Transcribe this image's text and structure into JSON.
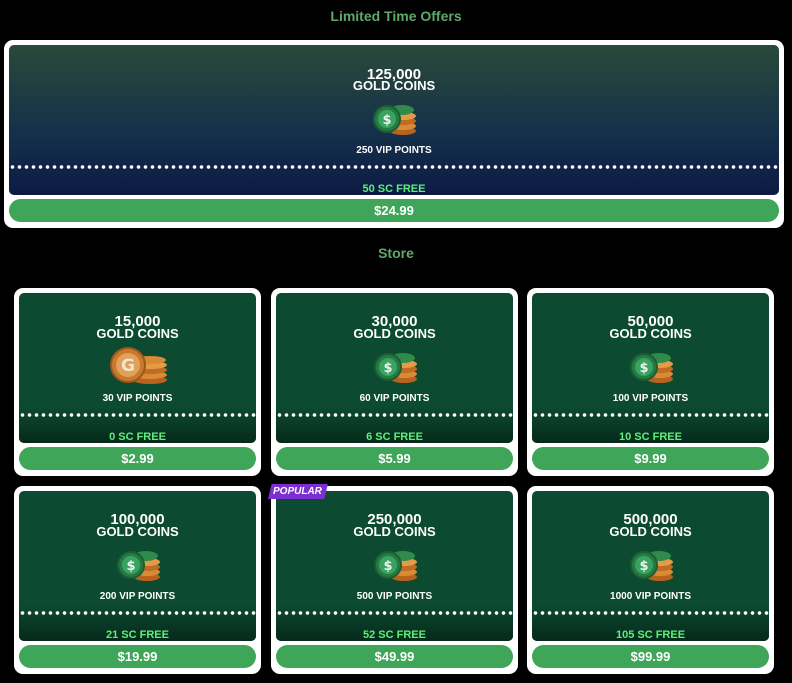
{
  "headings": {
    "limited": "Limited Time Offers",
    "store": "Store"
  },
  "colors": {
    "background": "#000000",
    "card_green": "#0c4a32",
    "price_button": "#3fa558",
    "sc_text": "#5cf07a",
    "heading": "#5fa86a",
    "popular_badge": "#7b2fd0"
  },
  "featured": {
    "amount": "125,000",
    "unit": "GOLD COINS",
    "icon": "green-coin-stack-icon",
    "vip": "250 VIP POINTS",
    "sc": "50 SC FREE",
    "price": "$24.99"
  },
  "packages": [
    {
      "amount": "15,000",
      "unit": "GOLD COINS",
      "icon": "gold-coin-stack-icon",
      "vip": "30 VIP POINTS",
      "sc": "0 SC FREE",
      "price": "$2.99"
    },
    {
      "amount": "30,000",
      "unit": "GOLD COINS",
      "icon": "green-coin-stack-icon",
      "vip": "60 VIP POINTS",
      "sc": "6 SC FREE",
      "price": "$5.99"
    },
    {
      "amount": "50,000",
      "unit": "GOLD COINS",
      "icon": "green-coin-stack-icon",
      "vip": "100 VIP POINTS",
      "sc": "10 SC FREE",
      "price": "$9.99"
    },
    {
      "amount": "100,000",
      "unit": "GOLD COINS",
      "icon": "green-coin-stack-icon",
      "vip": "200 VIP POINTS",
      "sc": "21 SC FREE",
      "price": "$19.99"
    },
    {
      "amount": "250,000",
      "unit": "GOLD COINS",
      "icon": "green-coin-stack-icon",
      "vip": "500 VIP POINTS",
      "sc": "52 SC FREE",
      "price": "$49.99",
      "badge": "POPULAR"
    },
    {
      "amount": "500,000",
      "unit": "GOLD COINS",
      "icon": "green-coin-stack-icon",
      "vip": "1000 VIP POINTS",
      "sc": "105 SC FREE",
      "price": "$99.99"
    }
  ]
}
